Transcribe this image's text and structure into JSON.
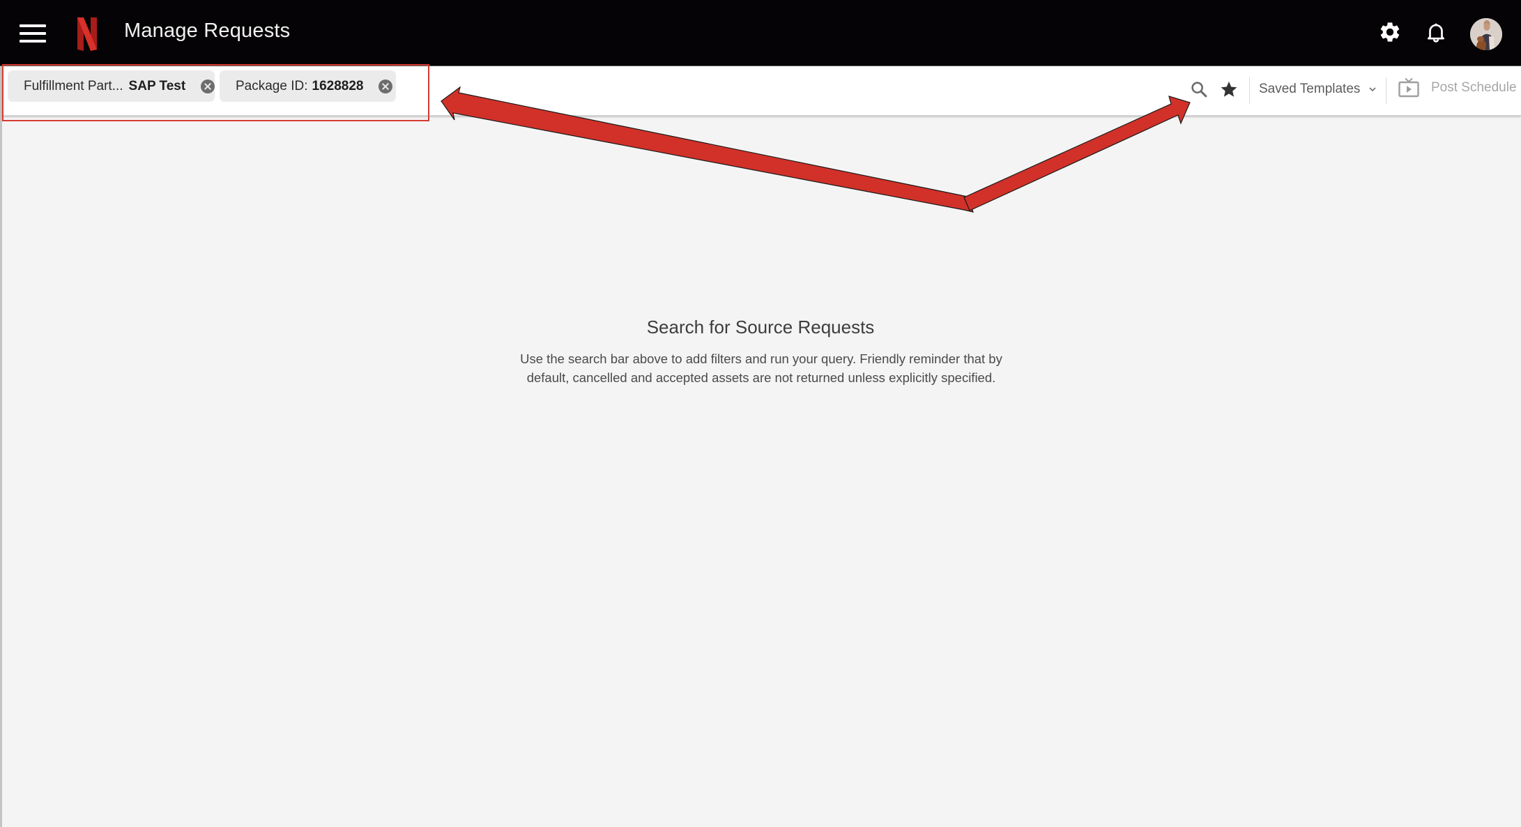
{
  "header": {
    "title": "Manage Requests",
    "menu_icon": "hamburger-menu-icon",
    "logo": "netflix-logo",
    "logo_color": "#c8231f",
    "settings_icon": "gear-icon",
    "notifications_icon": "bell-icon",
    "avatar": "user-avatar"
  },
  "filters": {
    "chips": [
      {
        "key": "Fulfillment Part...",
        "value": "SAP Test"
      },
      {
        "key": "Package ID:",
        "value": "1628828"
      }
    ]
  },
  "toolbar": {
    "search_icon": "search-icon",
    "favorite_icon": "star-icon",
    "saved_templates_label": "Saved Templates",
    "post_schedule_label": "Post Schedule",
    "post_schedule_icon": "tv-play-icon"
  },
  "empty_state": {
    "title": "Search for Source Requests",
    "body": "Use the search bar above to add filters and run your query. Friendly reminder that by default, cancelled and accepted assets are not returned unless explicitly specified."
  },
  "annotation": {
    "color": "#d13129",
    "description": "Red box highlighting filter chips; double-headed arrow pointing from the chips to the search/star toolbar icons"
  }
}
